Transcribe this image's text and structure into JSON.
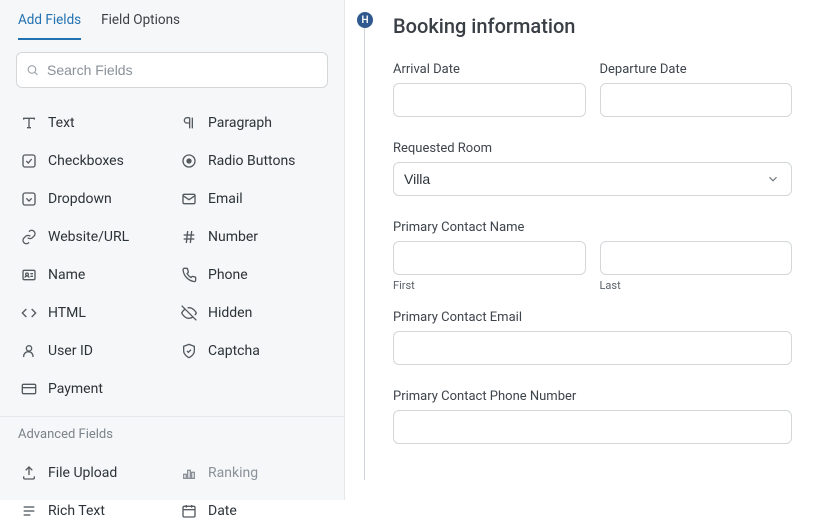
{
  "sidebar": {
    "tabs": {
      "add": "Add Fields",
      "options": "Field Options"
    },
    "search": {
      "placeholder": "Search Fields"
    },
    "fields": [
      {
        "label": "Text",
        "icon": "text-icon"
      },
      {
        "label": "Paragraph",
        "icon": "paragraph-icon"
      },
      {
        "label": "Checkboxes",
        "icon": "checkbox-icon"
      },
      {
        "label": "Radio Buttons",
        "icon": "radio-icon"
      },
      {
        "label": "Dropdown",
        "icon": "dropdown-icon"
      },
      {
        "label": "Email",
        "icon": "email-icon"
      },
      {
        "label": "Website/URL",
        "icon": "link-icon"
      },
      {
        "label": "Number",
        "icon": "hash-icon"
      },
      {
        "label": "Name",
        "icon": "name-icon"
      },
      {
        "label": "Phone",
        "icon": "phone-icon"
      },
      {
        "label": "HTML",
        "icon": "html-icon"
      },
      {
        "label": "Hidden",
        "icon": "hidden-icon"
      },
      {
        "label": "User ID",
        "icon": "user-icon"
      },
      {
        "label": "Captcha",
        "icon": "shield-icon"
      },
      {
        "label": "Payment",
        "icon": "card-icon"
      }
    ],
    "advanced_label": "Advanced Fields",
    "advanced_fields": [
      {
        "label": "File Upload",
        "icon": "upload-icon"
      },
      {
        "label": "Ranking",
        "icon": "ranking-icon",
        "muted": true
      },
      {
        "label": "Rich Text",
        "icon": "rich-text-icon"
      },
      {
        "label": "Date",
        "icon": "date-icon"
      }
    ]
  },
  "form": {
    "section_badge": "H",
    "heading": "Booking information",
    "labels": {
      "arrival": "Arrival Date",
      "departure": "Departure Date",
      "room": "Requested Room",
      "contact_name": "Primary Contact Name",
      "first": "First",
      "last": "Last",
      "contact_email": "Primary Contact Email",
      "contact_phone": "Primary Contact Phone Number"
    },
    "room_value": "Villa"
  }
}
